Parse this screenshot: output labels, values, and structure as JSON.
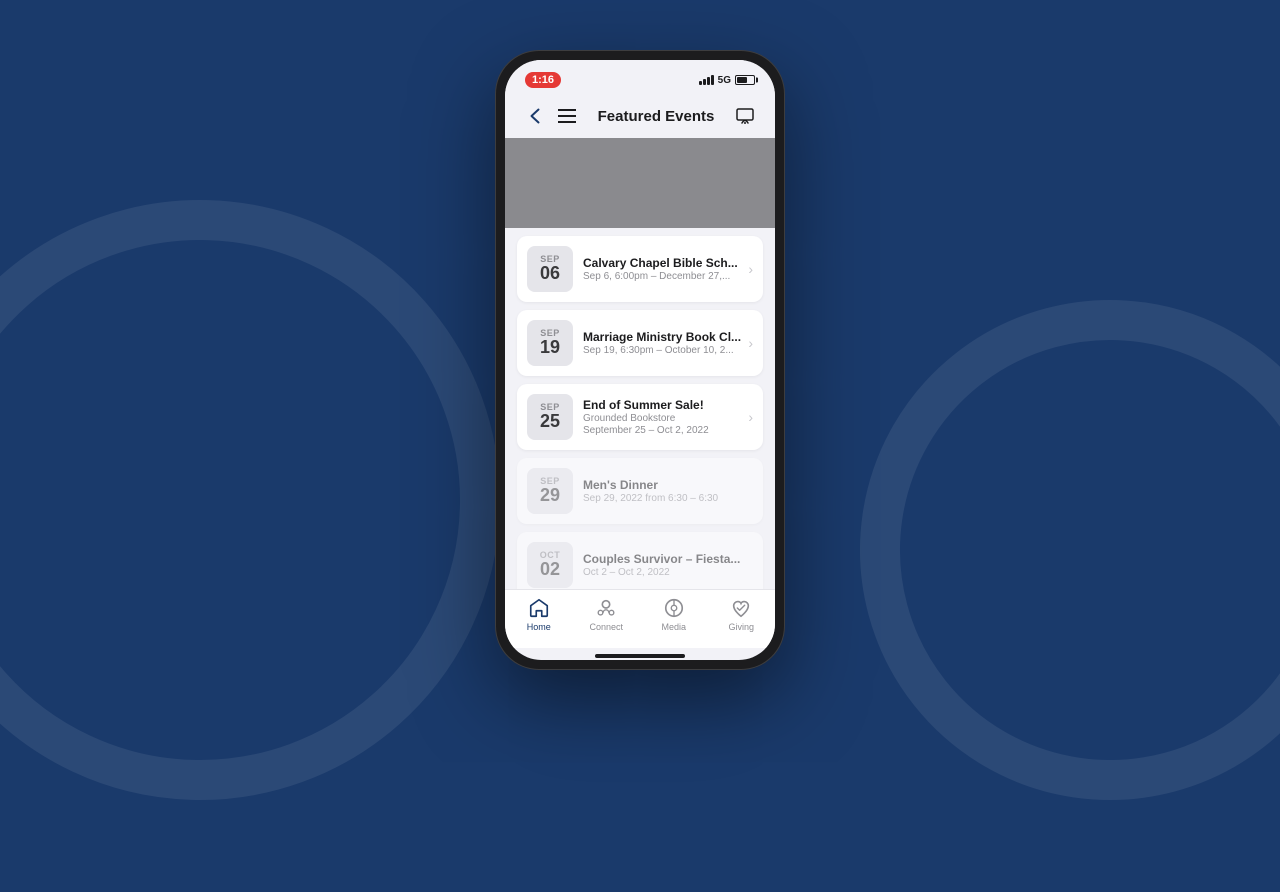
{
  "background": {
    "color": "#1a3a6b"
  },
  "status_bar": {
    "time": "1:16",
    "signal": "5G",
    "battery_level": 65
  },
  "nav": {
    "title": "Featured Events",
    "back_label": "back",
    "menu_label": "menu",
    "cast_label": "cast"
  },
  "events": [
    {
      "id": 1,
      "month": "SEP",
      "day": "06",
      "title": "Calvary Chapel Bible Sch...",
      "date_range": "Sep 6, 6:00pm – December 27,...",
      "faded": false
    },
    {
      "id": 2,
      "month": "SEP",
      "day": "19",
      "title": "Marriage Ministry Book Cl...",
      "date_range": "Sep 19, 6:30pm – October 10, 2...",
      "faded": false
    },
    {
      "id": 3,
      "month": "SEP",
      "day": "25",
      "title": "End of Summer Sale!",
      "subtitle": "Grounded Bookstore",
      "date_range": "September 25 – Oct 2, 2022",
      "faded": false
    },
    {
      "id": 4,
      "month": "SEP",
      "day": "29",
      "title": "Men's Dinner",
      "date_range": "Sep 29, 2022 from 6:30 – 6:30",
      "faded": true
    },
    {
      "id": 5,
      "month": "OCT",
      "day": "02",
      "title": "Couples Survivor – Fiesta...",
      "date_range": "Oct 2 – Oct 2, 2022",
      "faded": true
    }
  ],
  "tabs": [
    {
      "id": "home",
      "label": "Home",
      "active": true,
      "icon": "home-icon"
    },
    {
      "id": "connect",
      "label": "Connect",
      "active": false,
      "icon": "connect-icon"
    },
    {
      "id": "media",
      "label": "Media",
      "active": false,
      "icon": "media-icon"
    },
    {
      "id": "giving",
      "label": "Giving",
      "active": false,
      "icon": "giving-icon"
    }
  ]
}
